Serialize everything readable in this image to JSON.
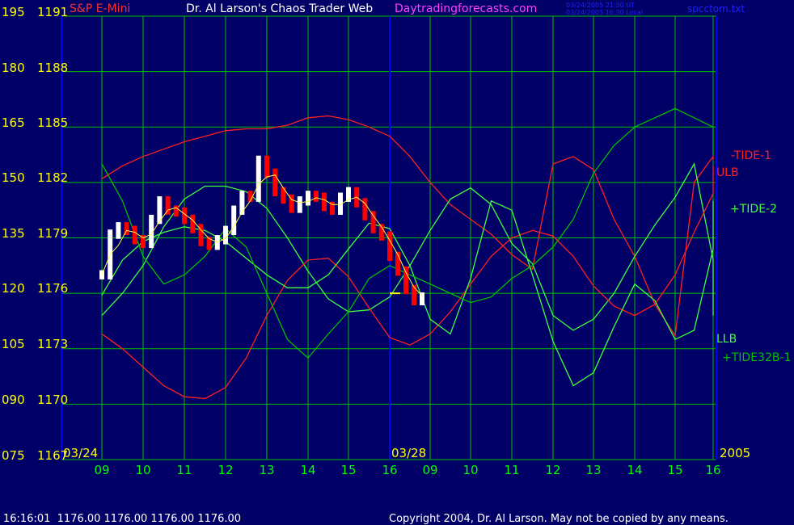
{
  "header": {
    "instrument": "S&P E-Mini",
    "title": "Dr. Al Larson's Chaos Trader Web",
    "site": "Daytradingforecasts.com",
    "timestamp_ut": "03/24/2005 21:30 UT",
    "timestamp_local": "03/24/2005 16:30 Local",
    "filename": "spcctom.txt"
  },
  "footer": {
    "status": "16:16:01  1176.00 1176.00 1176.00 1176.00",
    "copyright": "Copyright 2004, Dr. Al Larson. May not be copied by any means."
  },
  "colors": {
    "background": "#000066",
    "grid": "#00c000",
    "axis_labels": "#ffff00",
    "time_labels": "#00ff00",
    "title": "#ffffff",
    "site": "#ff40ff",
    "instrument": "#ff3030",
    "divider": "#0000ff",
    "ulb": "#ff2020",
    "llb": "#40ff40",
    "tide": "#00c000",
    "price_up": "#ffffff",
    "price_down": "#ff0000"
  },
  "chart_data": {
    "type": "line",
    "y_left_labels": [
      "195",
      "180",
      "165",
      "150",
      "135",
      "120",
      "105",
      "090",
      "075"
    ],
    "y_right_labels": [
      "1191",
      "1188",
      "1185",
      "1182",
      "1179",
      "1176",
      "1173",
      "1170",
      "1167"
    ],
    "ylim": [
      1167,
      1191
    ],
    "x_tick_labels": [
      "09",
      "10",
      "11",
      "12",
      "13",
      "14",
      "15",
      "16",
      "09",
      "10",
      "11",
      "12",
      "13",
      "14",
      "15",
      "16"
    ],
    "date_labels": [
      "03/24",
      "03/28",
      "2005"
    ],
    "last_price": 1176.0,
    "series_labels": [
      "-TIDE-1",
      "ULB",
      "+TIDE-2",
      "LLB",
      "+TIDE32B-1"
    ],
    "series": [
      {
        "name": "ULB",
        "x": [
          0,
          0.5,
          1,
          1.5,
          2,
          2.5,
          3,
          3.5,
          4,
          4.5,
          5,
          5.5,
          6,
          6.5,
          7,
          7.5,
          8,
          8.5,
          9,
          9.5,
          10,
          10.5,
          11,
          11.5,
          12,
          12.5,
          13,
          13.5,
          14,
          14.5,
          15,
          15.5
        ],
        "y": [
          1182.2,
          1182.9,
          1183.4,
          1183.8,
          1184.2,
          1184.5,
          1184.8,
          1184.9,
          1184.9,
          1185.1,
          1185.5,
          1185.6,
          1185.4,
          1185.0,
          1184.5,
          1183.4,
          1182.0,
          1180.8,
          1180.0,
          1179.2,
          1178.1,
          1177.3,
          1183.0,
          1183.4,
          1182.7,
          1180.0,
          1178.0,
          1175.4,
          1173.7,
          1182.0,
          1183.4,
          1183.2
        ]
      },
      {
        "name": "LLB",
        "x": [
          0,
          0.5,
          1,
          1.5,
          2,
          2.5,
          3,
          3.5,
          4,
          4.5,
          5,
          5.5,
          6,
          6.5,
          7,
          7.5,
          8,
          8.5,
          9,
          9.5,
          10,
          10.5,
          11,
          11.5,
          12,
          12.5,
          13,
          13.5,
          14,
          14.5,
          15,
          15.5
        ],
        "y": [
          1174.8,
          1176.0,
          1177.5,
          1179.6,
          1181.1,
          1181.8,
          1181.8,
          1181.5,
          1180.6,
          1179.0,
          1177.2,
          1175.7,
          1175.0,
          1175.1,
          1175.8,
          1177.5,
          1179.4,
          1181.1,
          1181.7,
          1180.8,
          1178.7,
          1177.6,
          1174.8,
          1174.0,
          1174.6,
          1176.0,
          1178.0,
          1179.7,
          1181.2,
          1183.0,
          1177.8,
          1174.8
        ]
      },
      {
        "name": "-TIDE-1",
        "x": [
          0,
          0.5,
          1,
          1.5,
          2,
          2.5,
          3,
          3.5,
          4,
          4.5,
          5,
          5.5,
          6,
          6.5,
          7,
          7.5,
          8,
          8.5,
          9,
          9.5,
          10,
          10.5,
          11,
          11.5,
          12,
          12.5,
          13,
          13.5,
          14,
          14.5,
          15,
          15.5
        ],
        "y": [
          1173.8,
          1173.0,
          1172.0,
          1171.0,
          1170.4,
          1170.3,
          1170.9,
          1172.5,
          1174.8,
          1176.7,
          1177.8,
          1177.9,
          1176.9,
          1175.2,
          1173.6,
          1173.2,
          1173.8,
          1175.0,
          1176.5,
          1178.0,
          1179.0,
          1179.4,
          1179.1,
          1178.0,
          1176.4,
          1175.3,
          1174.8,
          1175.4,
          1177.0,
          1179.3,
          1181.4,
          1182.9
        ]
      },
      {
        "name": "+TIDE-2",
        "x": [
          0,
          0.5,
          1,
          1.5,
          2,
          2.5,
          3,
          3.5,
          4,
          4.5,
          5,
          5.5,
          6,
          6.5,
          7,
          7.5,
          8,
          8.5,
          9,
          9.5,
          10,
          10.5,
          11,
          11.5,
          12,
          12.5,
          13,
          13.5,
          14,
          14.5,
          15,
          15.5
        ],
        "y": [
          1175.9,
          1177.8,
          1178.8,
          1179.3,
          1179.6,
          1179.4,
          1178.8,
          1177.9,
          1177.0,
          1176.3,
          1176.3,
          1177.0,
          1178.4,
          1179.8,
          1179.5,
          1177.5,
          1174.6,
          1173.8,
          1176.8,
          1181.0,
          1180.5,
          1177.0,
          1173.4,
          1171.0,
          1171.7,
          1174.2,
          1176.5,
          1175.6,
          1173.5,
          1174.0,
          1178.4,
          1181.0
        ]
      },
      {
        "name": "+TIDE32B-1",
        "x": [
          0,
          0.5,
          1,
          1.5,
          2,
          2.5,
          3,
          3.5,
          4,
          4.5,
          5,
          5.5,
          6,
          6.5,
          7,
          7.5,
          8,
          8.5,
          9,
          9.5,
          10,
          10.5,
          11,
          11.5,
          12,
          12.5,
          13,
          13.5,
          14,
          14.5,
          15,
          15.5
        ],
        "y": [
          1183.0,
          1181.0,
          1178.0,
          1176.5,
          1177.0,
          1178.0,
          1179.5,
          1178.5,
          1176.0,
          1173.5,
          1172.5,
          1173.8,
          1175.0,
          1176.8,
          1177.5,
          1177.0,
          1176.5,
          1176.0,
          1175.5,
          1175.8,
          1176.8,
          1177.5,
          1178.5,
          1180.0,
          1182.5,
          1184.0,
          1185.0,
          1185.5,
          1186.0,
          1185.5,
          1185.0,
          1183.5
        ]
      },
      {
        "name": "Price",
        "x": [
          0,
          0.2,
          0.4,
          0.6,
          0.8,
          1,
          1.2,
          1.4,
          1.6,
          1.8,
          2,
          2.2,
          2.4,
          2.6,
          2.8,
          3,
          3.2,
          3.4,
          3.6,
          3.8,
          4,
          4.2,
          4.4,
          4.6,
          4.8,
          5,
          5.2,
          5.4,
          5.6,
          5.8,
          6,
          6.2,
          6.4,
          6.6,
          6.8,
          7,
          7.2,
          7.4,
          7.6,
          7.8
        ],
        "y": [
          1177.0,
          1179.2,
          1179.6,
          1179.4,
          1178.9,
          1178.7,
          1180.0,
          1181.0,
          1180.5,
          1180.4,
          1180.0,
          1179.5,
          1178.8,
          1178.6,
          1178.9,
          1179.4,
          1180.5,
          1181.3,
          1181.2,
          1183.2,
          1182.5,
          1181.5,
          1181.1,
          1180.6,
          1181.0,
          1181.3,
          1181.2,
          1180.7,
          1180.5,
          1181.2,
          1181.5,
          1180.9,
          1180.2,
          1179.5,
          1179.1,
          1178.0,
          1177.2,
          1176.2,
          1175.6,
          1175.8
        ]
      }
    ]
  }
}
